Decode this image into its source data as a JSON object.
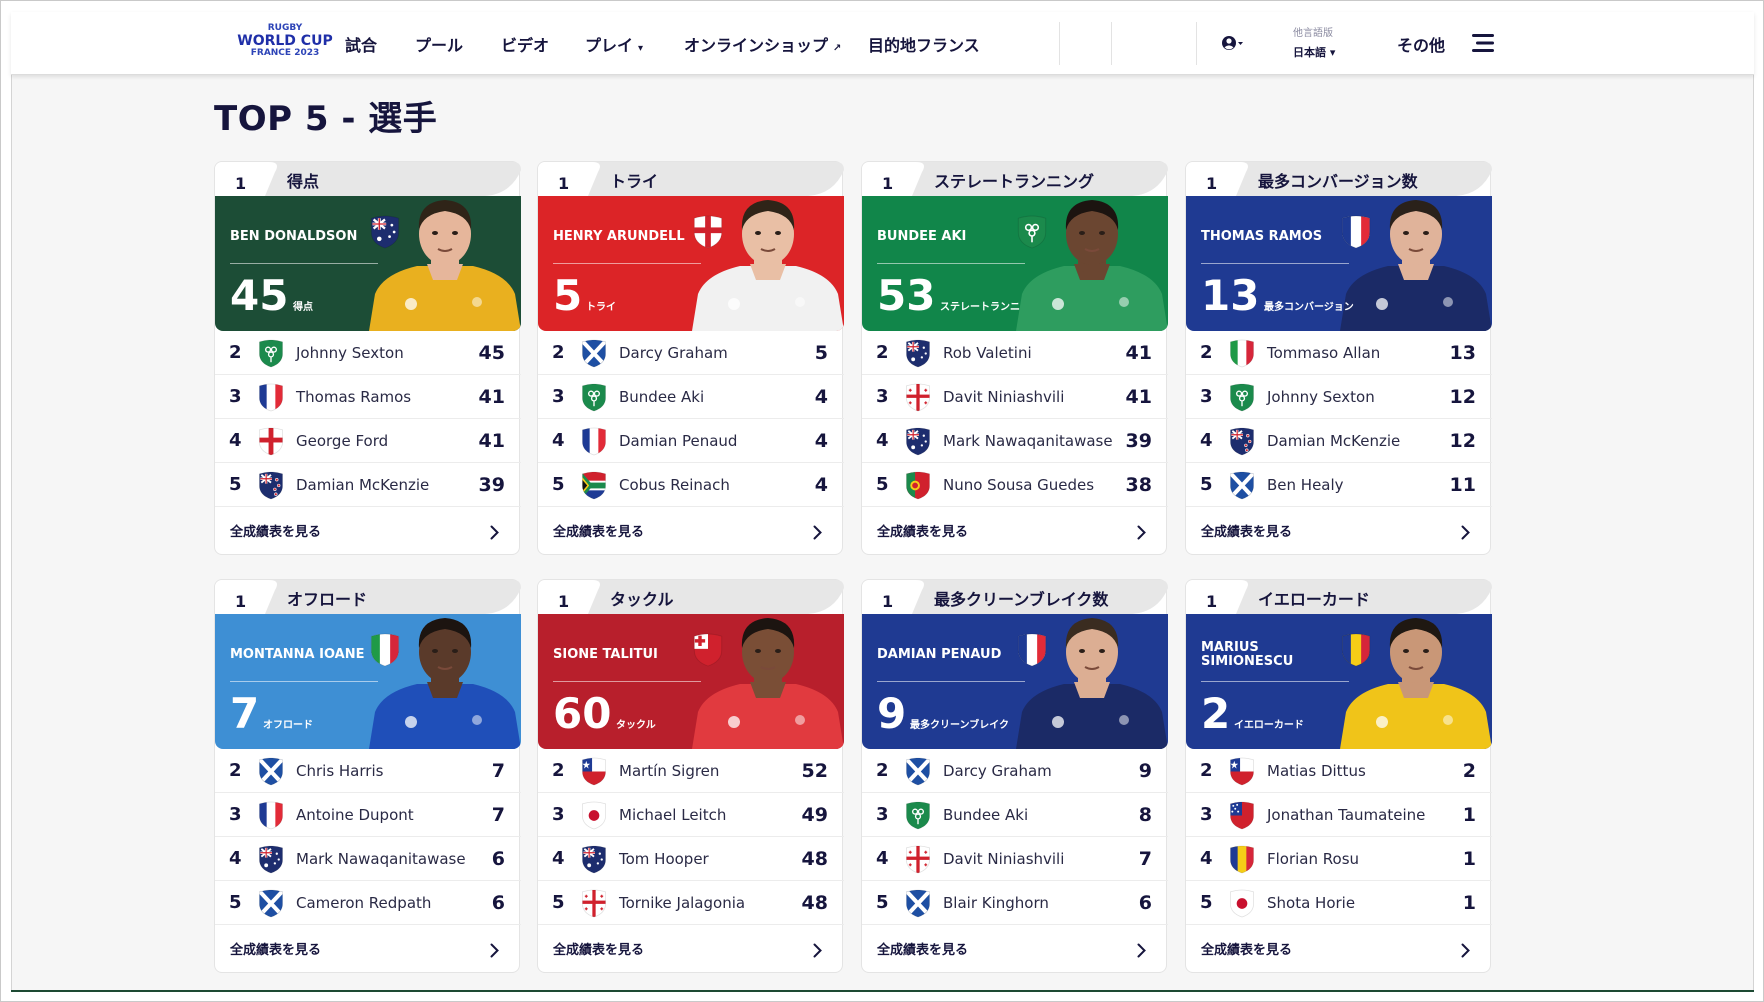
{
  "header": {
    "logo": {
      "line1": "RUGBY",
      "line2": "WORLD CUP",
      "line3": "FRANCE 2023"
    },
    "nav": [
      {
        "label": "試合",
        "caret": "",
        "ext": ""
      },
      {
        "label": "プール",
        "caret": "",
        "ext": ""
      },
      {
        "label": "ビデオ",
        "caret": "",
        "ext": ""
      },
      {
        "label": "プレイ",
        "caret": "▾",
        "ext": ""
      },
      {
        "label": "オンラインショップ",
        "caret": "",
        "ext": "↗"
      },
      {
        "label": "目的地フランス",
        "caret": "",
        "ext": ""
      }
    ],
    "user_caret": "▾",
    "language": {
      "label": "他言語版",
      "value": "日本語 ▾"
    },
    "more": "その他"
  },
  "page": {
    "title": "TOP 5 - 選手"
  },
  "link_label": "全成績表を見る",
  "colors": {
    "navy": "#16153d",
    "tab_grey": "#e7e7e7"
  },
  "cards": [
    {
      "category": "得点",
      "theme": "#1c4d36",
      "jersey": "#e9b01f",
      "skin": "#e6b69b",
      "hair": "#2f2418",
      "leader": {
        "rank": "1",
        "name": "BEN DONALDSON",
        "value": "45",
        "unit": "得点",
        "flag": "aus"
      },
      "rows": [
        {
          "rank": "2",
          "name": "Johnny Sexton",
          "value": "45",
          "flag": "irl"
        },
        {
          "rank": "3",
          "name": "Thomas Ramos",
          "value": "41",
          "flag": "fra"
        },
        {
          "rank": "4",
          "name": "George Ford",
          "value": "41",
          "flag": "eng"
        },
        {
          "rank": "5",
          "name": "Damian McKenzie",
          "value": "39",
          "flag": "nzl"
        }
      ]
    },
    {
      "category": "トライ",
      "theme": "#dc2427",
      "jersey": "#f1f1f1",
      "skin": "#e9bfa5",
      "hair": "#2f2418",
      "leader": {
        "rank": "1",
        "name": "HENRY ARUNDELL",
        "value": "5",
        "unit": "トライ",
        "flag": "eng"
      },
      "rows": [
        {
          "rank": "2",
          "name": "Darcy Graham",
          "value": "5",
          "flag": "sco"
        },
        {
          "rank": "3",
          "name": "Bundee Aki",
          "value": "4",
          "flag": "irl"
        },
        {
          "rank": "4",
          "name": "Damian Penaud",
          "value": "4",
          "flag": "fra"
        },
        {
          "rank": "5",
          "name": "Cobus Reinach",
          "value": "4",
          "flag": "rsa"
        }
      ]
    },
    {
      "category": "ステレートランニング",
      "theme": "#11864a",
      "jersey": "#2e9d5f",
      "skin": "#6b4631",
      "hair": "#1c1410",
      "leader": {
        "rank": "1",
        "name": "BUNDEE AKI",
        "value": "53",
        "unit": "ステレートランニ",
        "flag": "irl"
      },
      "rows": [
        {
          "rank": "2",
          "name": "Rob Valetini",
          "value": "41",
          "flag": "aus"
        },
        {
          "rank": "3",
          "name": "Davit Niniashvili",
          "value": "41",
          "flag": "geo"
        },
        {
          "rank": "4",
          "name": "Mark Nawaqanitawase",
          "value": "39",
          "flag": "aus"
        },
        {
          "rank": "5",
          "name": "Nuno Sousa Guedes",
          "value": "38",
          "flag": "por"
        }
      ]
    },
    {
      "category": "最多コンバージョン数",
      "theme": "#1f3a92",
      "jersey": "#1b2a66",
      "skin": "#e0b39a",
      "hair": "#2a211a",
      "leader": {
        "rank": "1",
        "name": "THOMAS RAMOS",
        "value": "13",
        "unit": "最多コンバージョン",
        "flag": "fra"
      },
      "rows": [
        {
          "rank": "2",
          "name": "Tommaso Allan",
          "value": "13",
          "flag": "ita"
        },
        {
          "rank": "3",
          "name": "Johnny Sexton",
          "value": "12",
          "flag": "irl"
        },
        {
          "rank": "4",
          "name": "Damian McKenzie",
          "value": "12",
          "flag": "nzl"
        },
        {
          "rank": "5",
          "name": "Ben Healy",
          "value": "11",
          "flag": "sco"
        }
      ]
    },
    {
      "category": "オフロード",
      "theme": "#3e8fd4",
      "jersey": "#1f4fb9",
      "skin": "#5a3a2a",
      "hair": "#1c1410",
      "leader": {
        "rank": "1",
        "name": "MONTANNA IOANE",
        "value": "7",
        "unit": "オフロード",
        "flag": "ita"
      },
      "rows": [
        {
          "rank": "2",
          "name": "Chris Harris",
          "value": "7",
          "flag": "sco"
        },
        {
          "rank": "3",
          "name": "Antoine Dupont",
          "value": "7",
          "flag": "fra"
        },
        {
          "rank": "4",
          "name": "Mark Nawaqanitawase",
          "value": "6",
          "flag": "aus"
        },
        {
          "rank": "5",
          "name": "Cameron Redpath",
          "value": "6",
          "flag": "sco"
        }
      ]
    },
    {
      "category": "タックル",
      "theme": "#b81f2c",
      "jersey": "#e13a3f",
      "skin": "#7a4e36",
      "hair": "#1c1410",
      "leader": {
        "rank": "1",
        "name": "SIONE TALITUI",
        "value": "60",
        "unit": "タックル",
        "flag": "tga"
      },
      "rows": [
        {
          "rank": "2",
          "name": "Martín Sigren",
          "value": "52",
          "flag": "chi"
        },
        {
          "rank": "3",
          "name": "Michael Leitch",
          "value": "49",
          "flag": "jpn"
        },
        {
          "rank": "4",
          "name": "Tom Hooper",
          "value": "48",
          "flag": "aus"
        },
        {
          "rank": "5",
          "name": "Tornike Jalagonia",
          "value": "48",
          "flag": "geo"
        }
      ]
    },
    {
      "category": "最多クリーンブレイク数",
      "theme": "#1f3a92",
      "jersey": "#1b2a66",
      "skin": "#dcae93",
      "hair": "#3a2c20",
      "leader": {
        "rank": "1",
        "name": "DAMIAN PENAUD",
        "value": "9",
        "unit": "最多クリーンブレイク",
        "flag": "fra"
      },
      "rows": [
        {
          "rank": "2",
          "name": "Darcy Graham",
          "value": "9",
          "flag": "sco"
        },
        {
          "rank": "3",
          "name": "Bundee Aki",
          "value": "8",
          "flag": "irl"
        },
        {
          "rank": "4",
          "name": "Davit Niniashvili",
          "value": "7",
          "flag": "geo"
        },
        {
          "rank": "5",
          "name": "Blair Kinghorn",
          "value": "6",
          "flag": "sco"
        }
      ]
    },
    {
      "category": "イエローカード",
      "theme": "#1f3a92",
      "jersey": "#f0c419",
      "skin": "#c99777",
      "hair": "#1f1812",
      "leader": {
        "rank": "1",
        "name": "MARIUS SIMIONESCU",
        "value": "2",
        "unit": "イエローカード",
        "flag": "rou"
      },
      "rows": [
        {
          "rank": "2",
          "name": "Matias Dittus",
          "value": "2",
          "flag": "chi"
        },
        {
          "rank": "3",
          "name": "Jonathan Taumateine",
          "value": "1",
          "flag": "sam"
        },
        {
          "rank": "4",
          "name": "Florian Rosu",
          "value": "1",
          "flag": "rou"
        },
        {
          "rank": "5",
          "name": "Shota Horie",
          "value": "1",
          "flag": "jpn"
        }
      ]
    }
  ]
}
